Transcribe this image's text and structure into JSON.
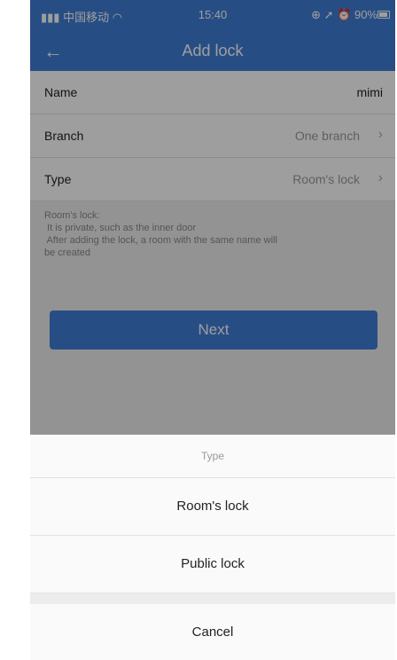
{
  "status": {
    "carrier": "中国移动",
    "time": "15:40",
    "battery": "90%"
  },
  "nav": {
    "title": "Add lock"
  },
  "form": {
    "name_label": "Name",
    "name_value": "mimi",
    "branch_label": "Branch",
    "branch_value": "One branch",
    "type_label": "Type",
    "type_value": "Room's lock"
  },
  "hint": [
    "Room's lock:",
    " It is private, such as the inner door",
    " After adding the lock, a room with the same name will",
    "be created"
  ],
  "next_label": "Next",
  "sheet": {
    "title": "Type",
    "options": [
      "Room's lock",
      "Public lock"
    ],
    "cancel": "Cancel"
  },
  "colors": {
    "primary": "#3f7fd5"
  }
}
